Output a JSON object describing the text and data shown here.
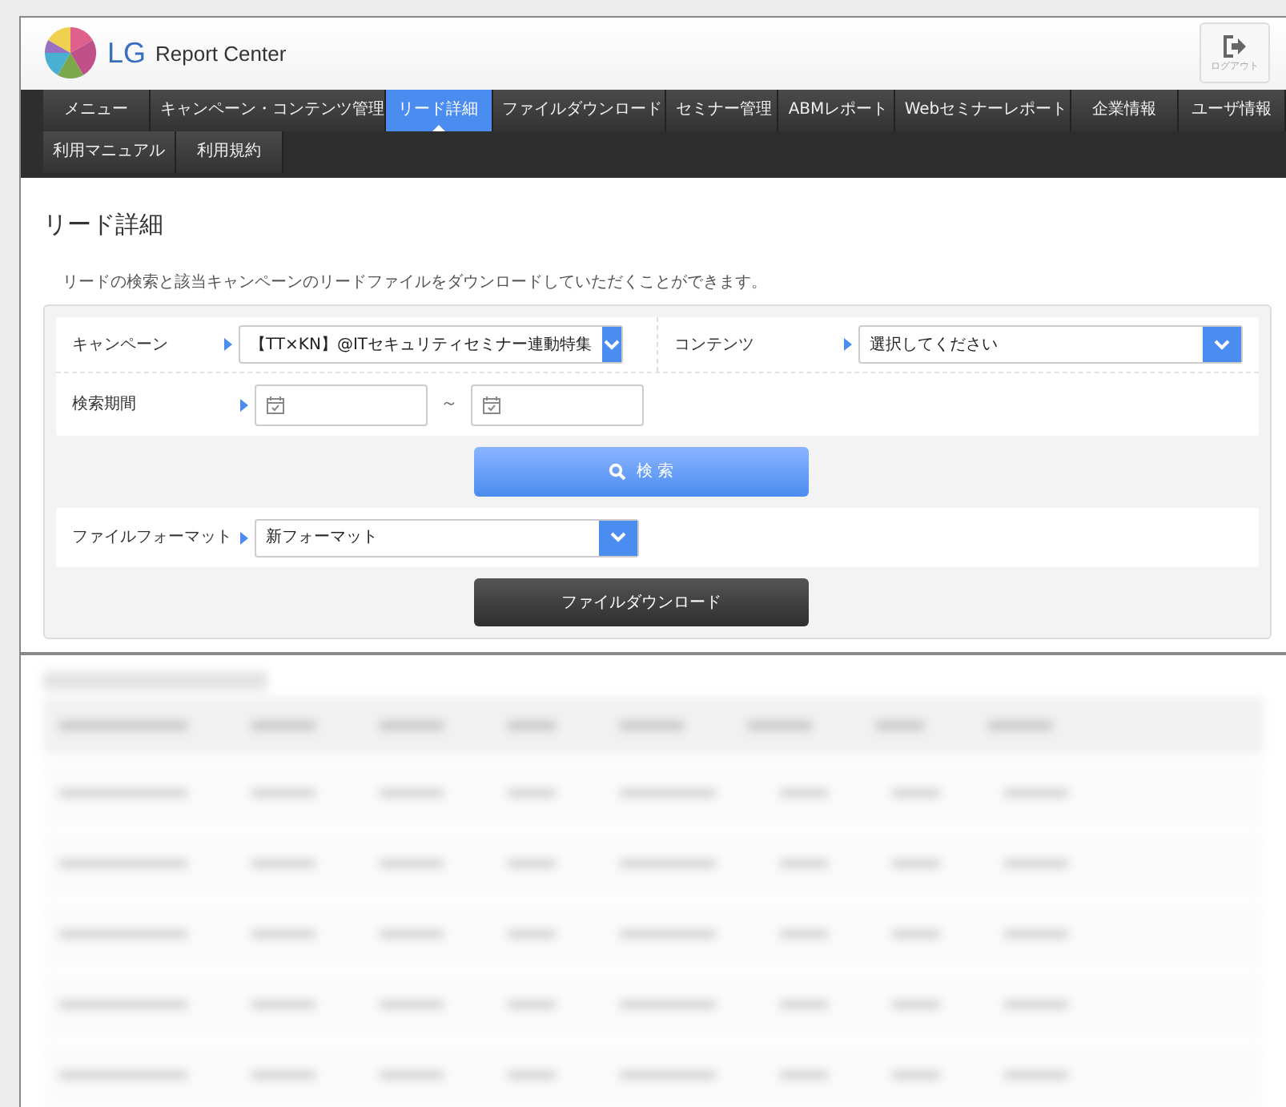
{
  "header": {
    "logo_text": "LG",
    "title": "Report Center",
    "logout": "ログアウト"
  },
  "nav": [
    {
      "label": "メニュー",
      "selected": false
    },
    {
      "label": "キャンペーン・コンテンツ管理",
      "selected": false
    },
    {
      "label": "リード詳細",
      "selected": true
    },
    {
      "label": "ファイルダウンロード",
      "selected": false
    },
    {
      "label": "セミナー管理",
      "selected": false
    },
    {
      "label": "ABMレポート",
      "selected": false
    },
    {
      "label": "Webセミナーレポート",
      "selected": false
    },
    {
      "label": "企業情報",
      "selected": false
    },
    {
      "label": "ユーザ情報",
      "selected": false
    },
    {
      "label": "利用マニュアル",
      "selected": false
    },
    {
      "label": "利用規約",
      "selected": false
    }
  ],
  "page": {
    "title": "リード詳細",
    "description": "リードの検索と該当キャンペーンのリードファイルをダウンロードしていただくことができます。"
  },
  "form": {
    "campaign": {
      "label": "キャンペーン",
      "value": "【TT×KN】@ITセキュリティセミナー連動特集"
    },
    "contents": {
      "label": "コンテンツ",
      "value": "選択してください"
    },
    "period": {
      "label": "検索期間",
      "separator": "～"
    },
    "search_button": "検 索",
    "file_format": {
      "label": "ファイルフォーマット",
      "value": "新フォーマット"
    },
    "download_button": "ファイルダウンロード"
  }
}
